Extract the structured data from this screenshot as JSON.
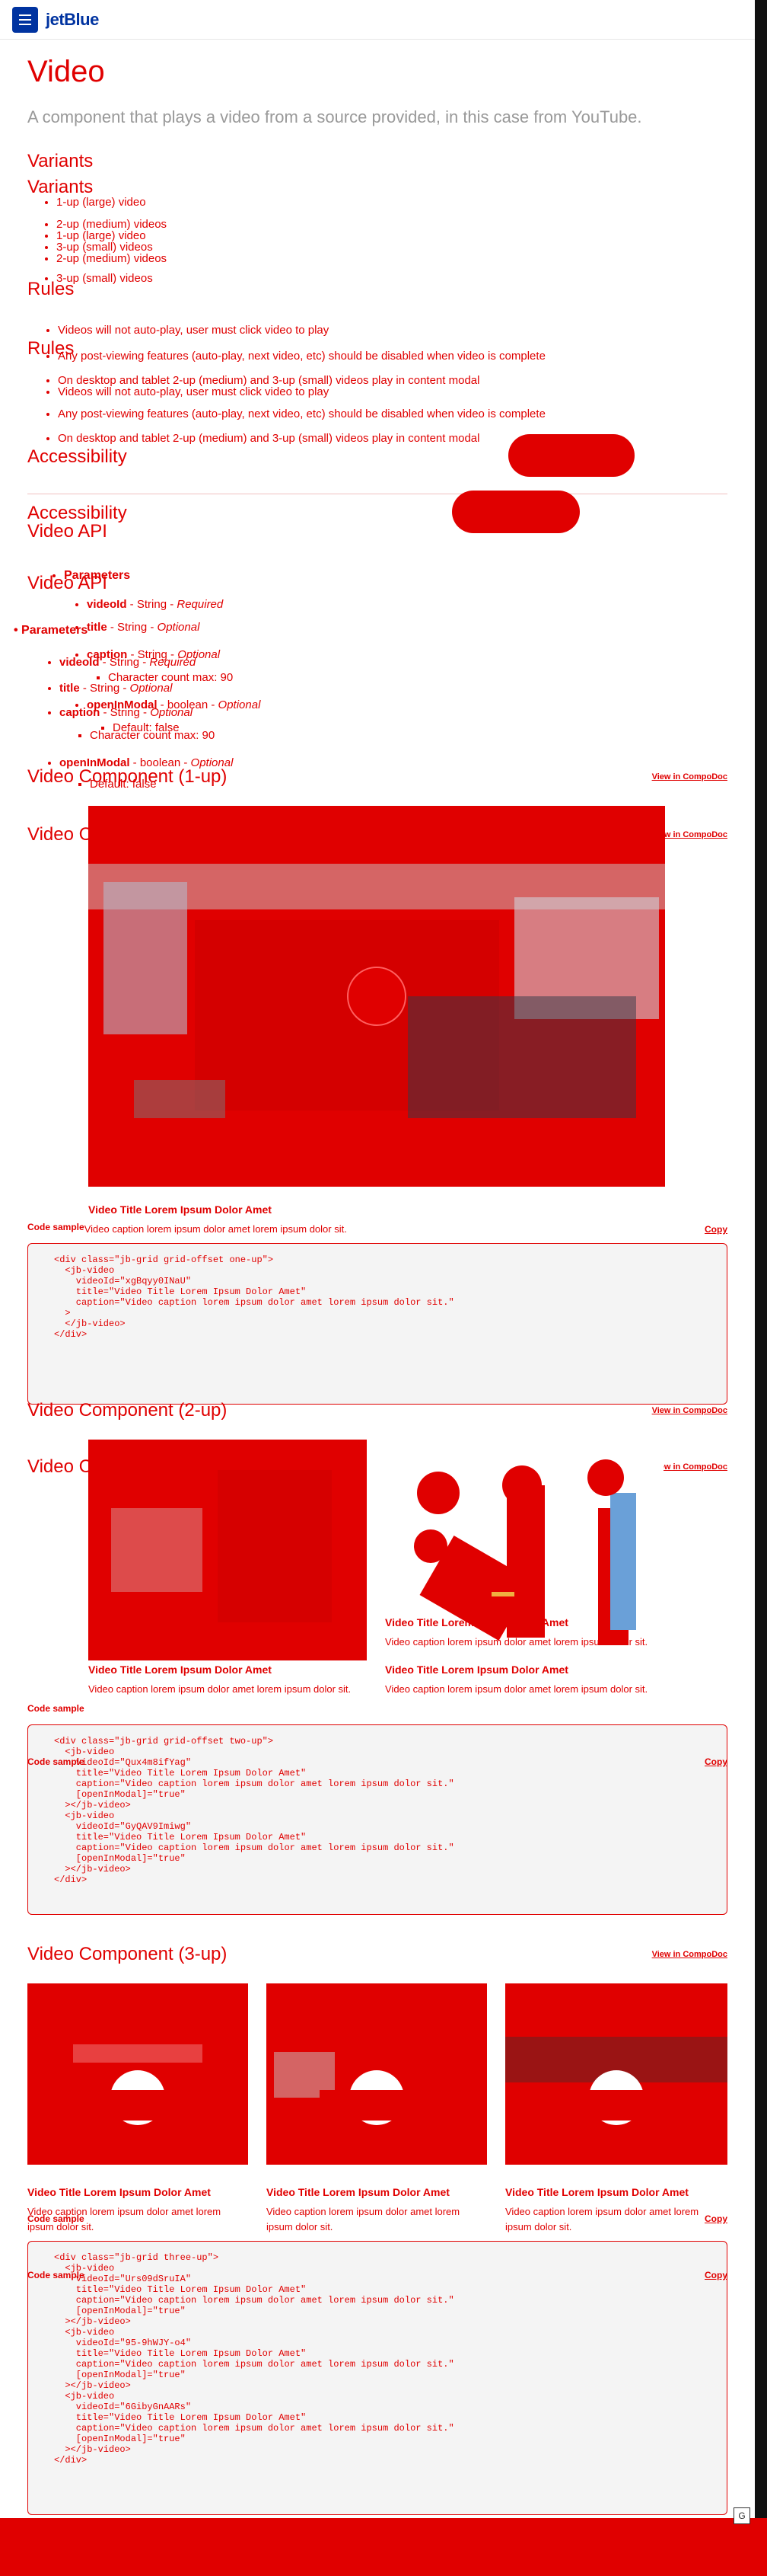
{
  "header": {
    "logo": "jetBlue"
  },
  "page": {
    "title": "Video",
    "description": "A component that plays a video from a source provided, in this case from YouTube."
  },
  "variants": {
    "heading": "Variants",
    "items": [
      "1-up (large) video",
      "2-up (medium) videos",
      "3-up (small) videos"
    ]
  },
  "rules": {
    "heading": "Rules",
    "items": [
      "Videos will not auto-play, user must click video to play",
      "Any post-viewing features (auto-play, next video, etc) should be disabled when video is complete",
      "On desktop and tablet 2-up (medium) and 3-up (small) videos play in content modal"
    ]
  },
  "accessibility": {
    "heading": "Accessibility"
  },
  "api": {
    "heading": "Video API",
    "params_heading": "Parameters",
    "params": [
      {
        "name": "videoId",
        "type": " - String - ",
        "req": "Required"
      },
      {
        "name": "title",
        "type": " - String - ",
        "req": "Optional"
      },
      {
        "name": "caption",
        "type": " - String - ",
        "req": "Optional",
        "sub": "Character count max: 90"
      },
      {
        "name": "openInModal",
        "type": " - boolean - ",
        "req": "Optional",
        "sub": "Default: false"
      }
    ]
  },
  "one_up": {
    "heading": "Video Component (1-up)",
    "link": "View in CompoDoc",
    "video_title": "Video Title Lorem Ipsum Dolor Amet",
    "video_caption": "Video caption lorem ipsum dolor amet lorem ipsum dolor sit.",
    "code_label": "Code sample",
    "copy": "Copy",
    "code": "<div class=\"jb-grid grid-offset one-up\">\n  <jb-video\n    videoId=\"xgBqyy0INaU\"\n    title=\"Video Title Lorem Ipsum Dolor Amet\"\n    caption=\"Video caption lorem ipsum dolor amet lorem ipsum dolor sit.\"\n  >\n  </jb-video>\n</div>"
  },
  "two_up": {
    "heading": "Video Component (2-up)",
    "link": "View in CompoDoc",
    "videos": [
      {
        "title": "Video Title Lorem Ipsum Dolor Amet",
        "caption": "Video caption lorem ipsum dolor amet lorem ipsum dolor sit."
      },
      {
        "title": "Video Title Lorem Ipsum Dolor Amet",
        "caption": "Video caption lorem ipsum dolor amet lorem ipsum dolor sit."
      }
    ],
    "code_label": "Code sample",
    "copy": "Copy",
    "code": "<div class=\"jb-grid grid-offset two-up\">\n  <jb-video\n    videoId=\"Qux4m8ifYag\"\n    title=\"Video Title Lorem Ipsum Dolor Amet\"\n    caption=\"Video caption lorem ipsum dolor amet lorem ipsum dolor sit.\"\n    [openInModal]=\"true\"\n  ></jb-video>\n  <jb-video\n    videoId=\"GyQAV9Imiwg\"\n    title=\"Video Title Lorem Ipsum Dolor Amet\"\n    caption=\"Video caption lorem ipsum dolor amet lorem ipsum dolor sit.\"\n    [openInModal]=\"true\"\n  ></jb-video>\n</div>"
  },
  "three_up": {
    "heading": "Video Component (3-up)",
    "link": "View in CompoDoc",
    "videos": [
      {
        "title": "Video Title Lorem Ipsum Dolor Amet",
        "caption": "Video caption lorem ipsum dolor amet lorem ipsum dolor sit."
      },
      {
        "title": "Video Title Lorem Ipsum Dolor Amet",
        "caption": "Video caption lorem ipsum dolor amet lorem ipsum dolor sit."
      },
      {
        "title": "Video Title Lorem Ipsum Dolor Amet",
        "caption": "Video caption lorem ipsum dolor amet lorem ipsum dolor sit."
      }
    ],
    "code_label": "Code sample",
    "copy": "Copy",
    "code": "<div class=\"jb-grid three-up\">\n  <jb-video\n    videoId=\"Urs09dSruIA\"\n    title=\"Video Title Lorem Ipsum Dolor Amet\"\n    caption=\"Video caption lorem ipsum dolor amet lorem ipsum dolor sit.\"\n    [openInModal]=\"true\"\n  ></jb-video>\n  <jb-video\n    videoId=\"95-9hWJY-o4\"\n    title=\"Video Title Lorem Ipsum Dolor Amet\"\n    caption=\"Video caption lorem ipsum dolor amet lorem ipsum dolor sit.\"\n    [openInModal]=\"true\"\n  ></jb-video>\n  <jb-video\n    videoId=\"6GibyGnAARs\"\n    title=\"Video Title Lorem Ipsum Dolor Amet\"\n    caption=\"Video caption lorem ipsum dolor amet lorem ipsum dolor sit.\"\n    [openInModal]=\"true\"\n  ></jb-video>\n</div>"
  },
  "footer": {
    "badge": "G"
  },
  "colors": {
    "brand": "#0033a0",
    "accent": "#e00000"
  }
}
